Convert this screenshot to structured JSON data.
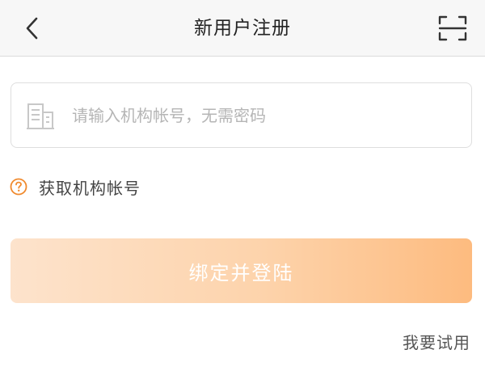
{
  "header": {
    "title": "新用户注册",
    "back_icon": "chevron-left-icon",
    "scan_icon": "scan-icon"
  },
  "account_input": {
    "value": "",
    "placeholder": "请输入机构帐号，无需密码",
    "icon": "building-icon"
  },
  "help": {
    "label": "获取机构帐号",
    "icon": "question-circle-icon"
  },
  "bind_button": {
    "label": "绑定并登陆"
  },
  "trial_link": {
    "label": "我要试用"
  },
  "colors": {
    "accent": "#F08A2E",
    "button_start": "#FDE3CC",
    "button_end": "#FDBB7F",
    "header_bg": "#F7F7F7"
  }
}
